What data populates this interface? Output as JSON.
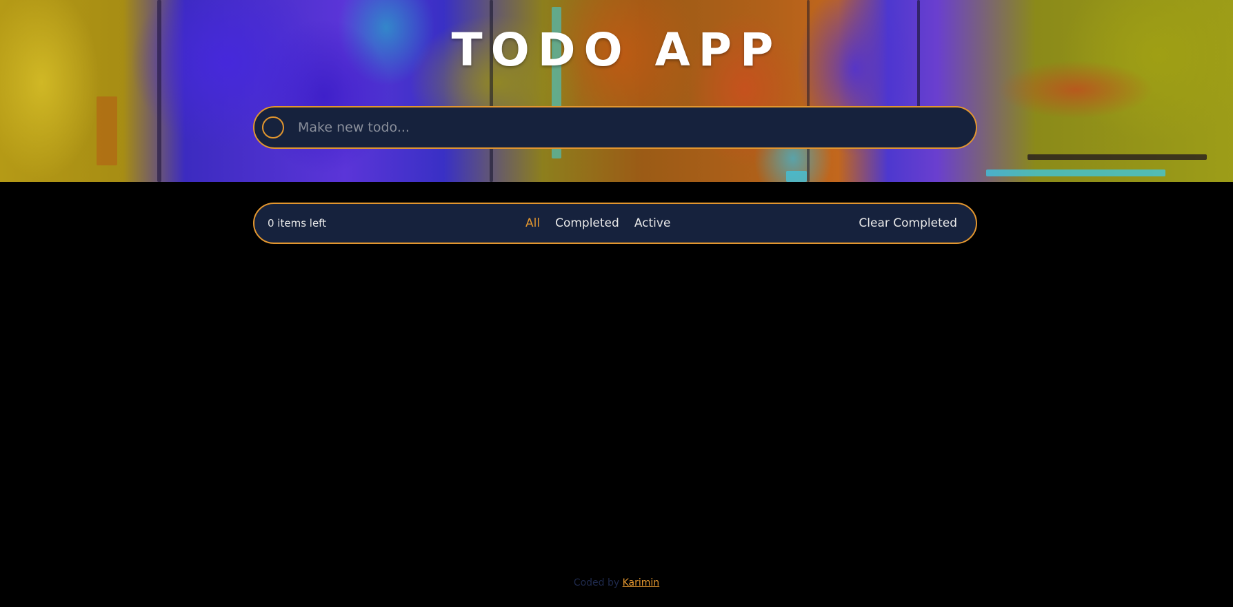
{
  "header": {
    "title": "TODO APP"
  },
  "new_todo": {
    "placeholder": "Make new todo..."
  },
  "status_bar": {
    "items_left": "0 items left",
    "filters": [
      {
        "label": "All",
        "active": true
      },
      {
        "label": "Completed",
        "active": false
      },
      {
        "label": "Active",
        "active": false
      }
    ],
    "clear_label": "Clear Completed"
  },
  "credit": {
    "prefix": "Coded by ",
    "author": "Karimin"
  },
  "colors": {
    "accent": "#e2962f",
    "panel": "#16223d",
    "background": "#000000"
  }
}
